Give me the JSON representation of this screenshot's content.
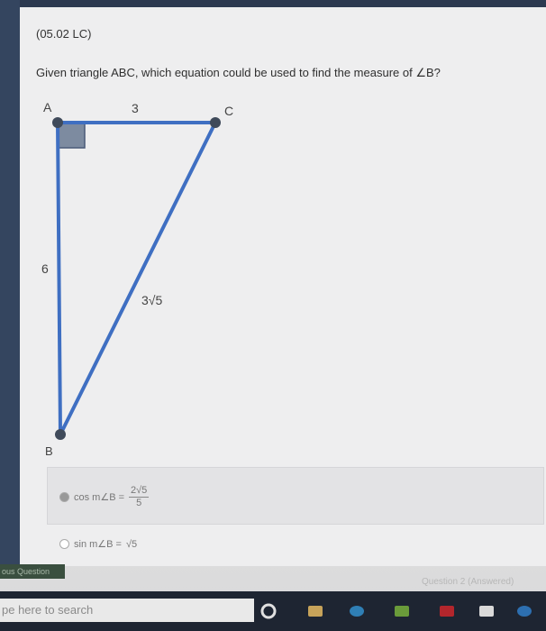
{
  "question_code": "(05.02 LC)",
  "question_text": "Given triangle ABC, which equation could be used to find the measure of ∠B?",
  "diagram": {
    "vertex_a": "A",
    "vertex_b": "B",
    "vertex_c": "C",
    "side_ac": "3",
    "side_ab": "6",
    "side_bc": "3√5"
  },
  "options": [
    {
      "prefix": "cos m∠B =",
      "numerator": "2√5",
      "denominator": "5",
      "selected": true
    },
    {
      "prefix": "sin m∠B =",
      "value": "√5",
      "selected": false
    }
  ],
  "nav": {
    "prev_label": "ous Question",
    "next_label": "Question 2 (Answered)"
  },
  "taskbar": {
    "search_placeholder": "pe here to search"
  },
  "colors": {
    "triangle_blue": "#3f6fc2",
    "vertex_dot": "#3f4a5a",
    "right_angle_fill": "#7d8ba0"
  }
}
